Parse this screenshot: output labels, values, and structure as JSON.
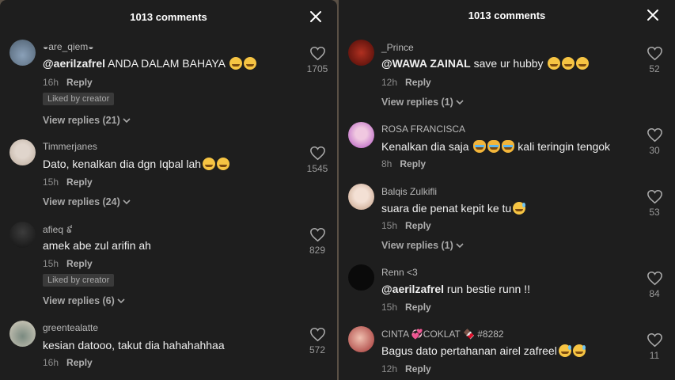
{
  "left": {
    "title": "1013 comments",
    "comments": [
      {
        "user": "◒are_qiem◒",
        "mention": "@aerilzafrel",
        "text": " ANDA DALAM BAHAYA",
        "emojis": [
          "laugh",
          "rofl"
        ],
        "time": "16h",
        "reply": "Reply",
        "badge": "Liked by creator",
        "view_replies": "View replies (21)",
        "likes": "1705"
      },
      {
        "user": "Timmerjanes",
        "mention": "",
        "text": "Dato, kenalkan dia dgn Iqbal lah",
        "emojis": [
          "rofl",
          "rofl"
        ],
        "time": "15h",
        "reply": "Reply",
        "badge": "",
        "view_replies": "View replies (24)",
        "likes": "1545"
      },
      {
        "user": "afieq ៩",
        "mention": "",
        "text": "amek abe zul arifin ah",
        "emojis": [],
        "time": "15h",
        "reply": "Reply",
        "badge": "Liked by creator",
        "view_replies": "View replies (6)",
        "likes": "829"
      },
      {
        "user": "greentealatte",
        "mention": "",
        "text": "kesian datooo, takut dia hahahahhaa",
        "emojis": [],
        "time": "16h",
        "reply": "Reply",
        "badge": "",
        "view_replies": "",
        "likes": "572"
      }
    ]
  },
  "right": {
    "title": "1013 comments",
    "comments": [
      {
        "user": "_Prince",
        "mention": "@WAWA ZAINAL",
        "text": " save ur hubby",
        "emojis": [
          "rofl",
          "rofl",
          "rofl"
        ],
        "time": "12h",
        "reply": "Reply",
        "view_replies": "View replies (1)",
        "likes": "52"
      },
      {
        "user": "ROSA FRANCISCA",
        "mention": "",
        "text": "Kenalkan dia saja ",
        "emojis": [
          "cat",
          "cat",
          "cat"
        ],
        "text_after": " kali teringin tengok",
        "time": "8h",
        "reply": "Reply",
        "view_replies": "",
        "likes": "30"
      },
      {
        "user": "Balqis Zulkifli",
        "mention": "",
        "text": "suara die penat kepit ke tu",
        "emojis": [
          "sweat"
        ],
        "time": "15h",
        "reply": "Reply",
        "view_replies": "View replies (1)",
        "likes": "53"
      },
      {
        "user": "Renn <3",
        "mention": "@aerilzafrel",
        "text": " run bestie runn !!",
        "emojis": [],
        "time": "15h",
        "reply": "Reply",
        "view_replies": "",
        "likes": "84"
      },
      {
        "user": "CINTA 💞COKLAT 🍫 #8282",
        "mention": "",
        "text": "Bagus dato pertahanan airel zafreel",
        "emojis": [
          "sweat",
          "sweat"
        ],
        "time": "12h",
        "reply": "Reply",
        "view_replies": "",
        "likes": "11"
      }
    ]
  },
  "icons": {
    "close": "close-icon",
    "heart": "heart-outline-icon",
    "chevron": "chevron-down-icon"
  },
  "colors": {
    "panel_bg": "#1e1e1e",
    "text": "#efefef",
    "muted": "#8c8c8c"
  }
}
